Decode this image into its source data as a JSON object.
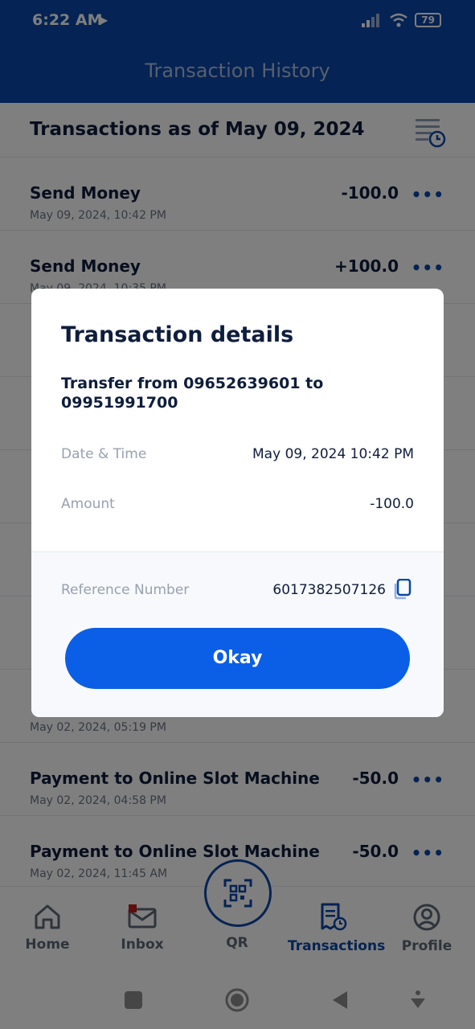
{
  "status_bar": {
    "time": "6:22 AM",
    "battery": "79"
  },
  "app_bar": {
    "title": "Transaction History"
  },
  "list": {
    "header": "Transactions as of May 09, 2024",
    "rows": [
      {
        "title": "Send Money",
        "amount": "-100.0",
        "date": "May 09, 2024, 10:42 PM"
      },
      {
        "title": "Send Money",
        "amount": "+100.0",
        "date": "May 09, 2024, 10:35 PM"
      },
      {
        "date": "May 02, 2024, 05:19 PM"
      },
      {
        "title": "Payment to Online Slot Machine",
        "amount": "-50.0",
        "date": "May 02, 2024, 04:58 PM"
      },
      {
        "title": "Payment to Online Slot Machine",
        "amount": "-50.0",
        "date": "May 02, 2024, 11:45 AM"
      }
    ]
  },
  "bottom_nav": {
    "items": [
      {
        "label": "Home",
        "icon": "home-icon"
      },
      {
        "label": "Inbox",
        "icon": "mail-icon"
      },
      {
        "label": "QR",
        "icon": "qr-scan-icon"
      },
      {
        "label": "Transactions",
        "icon": "receipt-icon",
        "active": true
      },
      {
        "label": "Profile",
        "icon": "user-icon"
      }
    ]
  },
  "modal": {
    "title": "Transaction details",
    "subtitle": "Transfer from 09652639601 to 09951991700",
    "date_label": "Date & Time",
    "date_value": "May 09, 2024 10:42 PM",
    "amount_label": "Amount",
    "amount_value": "-100.0",
    "reference_label": "Reference Number",
    "reference_value": "6017382507126",
    "button": "Okay"
  },
  "colors": {
    "brand": "#0b47a8",
    "button": "#0b5ee6",
    "text": "#0f1d3d"
  }
}
